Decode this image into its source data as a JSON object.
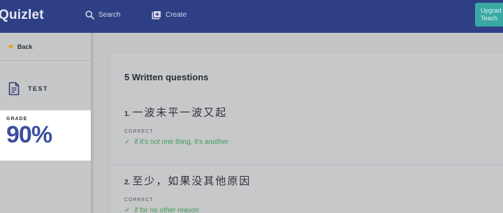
{
  "header": {
    "logo": "Quizlet",
    "search_label": "Search",
    "create_label": "Create",
    "upgrade_label": "Upgrad\nTeach"
  },
  "sidebar": {
    "back_label": "Back",
    "test_label": "TEST",
    "grade_label": "GRADE",
    "grade_value": "90%"
  },
  "main": {
    "title": "5 Written questions",
    "questions": [
      {
        "number": "1.",
        "prompt": "一波未平一波又起",
        "status": "CORRECT",
        "answer": "if it's not one thing, it's another"
      },
      {
        "number": "2.",
        "prompt": "至少，如果没其他原因",
        "status": "CORRECT",
        "answer": "if for no other reason"
      }
    ]
  },
  "colors": {
    "header_bg": "#2f3f85",
    "upgrade_bg": "#3aa9a4",
    "grade_color": "#3d4d9f",
    "correct_color": "#3c9a56",
    "back_chevron": "#e3a21a"
  }
}
